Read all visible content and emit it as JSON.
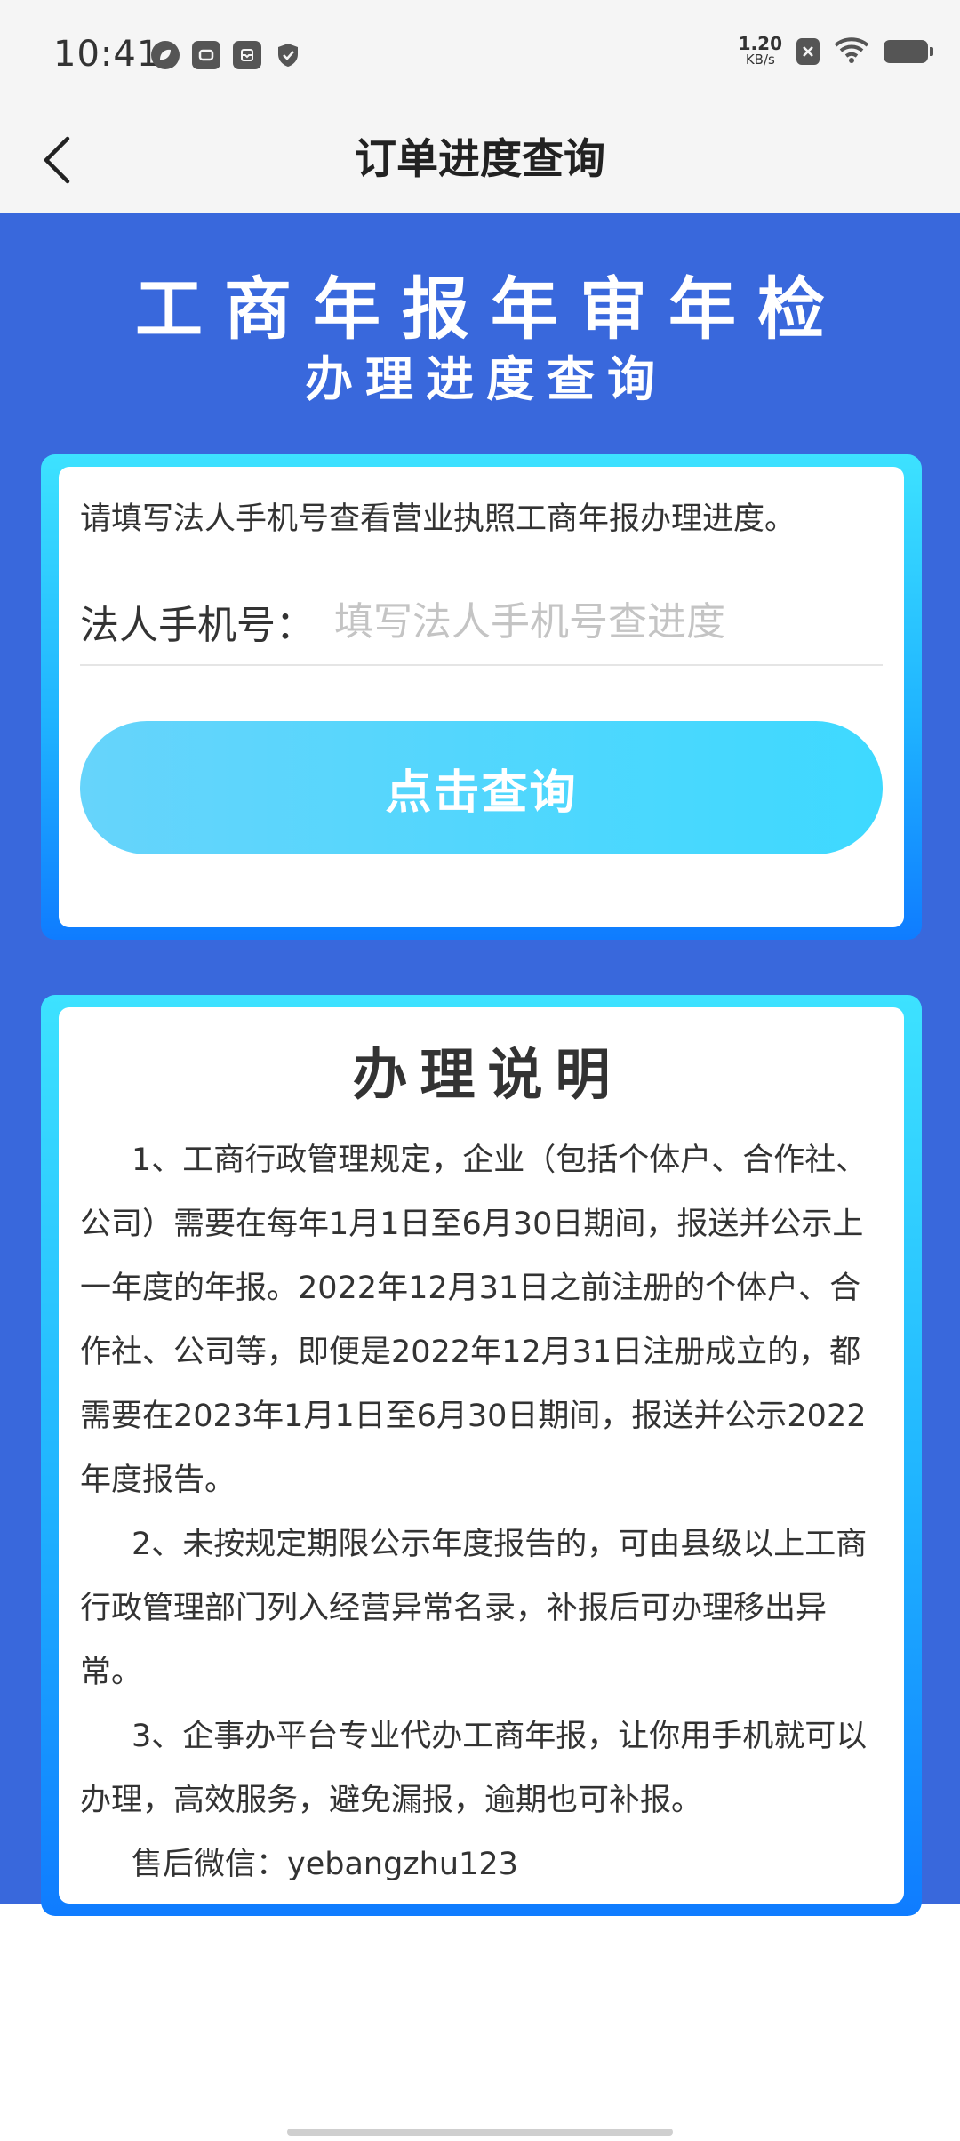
{
  "status_bar": {
    "time": "10:41",
    "net_speed_value": "1.20",
    "net_speed_unit": "KB/s",
    "icons": [
      "leaf-icon",
      "card-icon",
      "inbox-icon",
      "shield-icon",
      "close-box-icon",
      "wifi-icon",
      "battery-icon"
    ]
  },
  "nav": {
    "title": "订单进度查询",
    "back_icon": "chevron-left-icon"
  },
  "hero": {
    "title": "工商年报年审年检",
    "subtitle": "办理进度查询"
  },
  "query_card": {
    "hint": "请填写法人手机号查看营业执照工商年报办理进度。",
    "phone_label": "法人手机号：",
    "phone_value": "",
    "phone_placeholder": "填写法人手机号查进度",
    "button_label": "点击查询"
  },
  "info_card": {
    "title": "办理说明",
    "paragraphs": [
      "1、工商行政管理规定，企业（包括个体户、合作社、公司）需要在每年1月1日至6月30日期间，报送并公示上一年度的年报。2022年12月31日之前注册的个体户、合作社、公司等，即便是2022年12月31日注册成立的，都需要在2023年1月1日至6月30日期间，报送并公示2022年度报告。",
      "2、未按规定期限公示年度报告的，可由县级以上工商行政管理部门列入经营异常名录，补报后可办理移出异常。",
      "3、企事办平台专业代办工商年报，让你用手机就可以办理，高效服务，避免漏报，逾期也可补报。",
      "售后微信：yebangzhu123"
    ]
  },
  "colors": {
    "blue_bg": "#3968dc",
    "frame_top": "#3de2ff",
    "frame_bottom": "#0f7cff",
    "button_start": "#66d4fb",
    "button_end": "#3ed9ff"
  }
}
